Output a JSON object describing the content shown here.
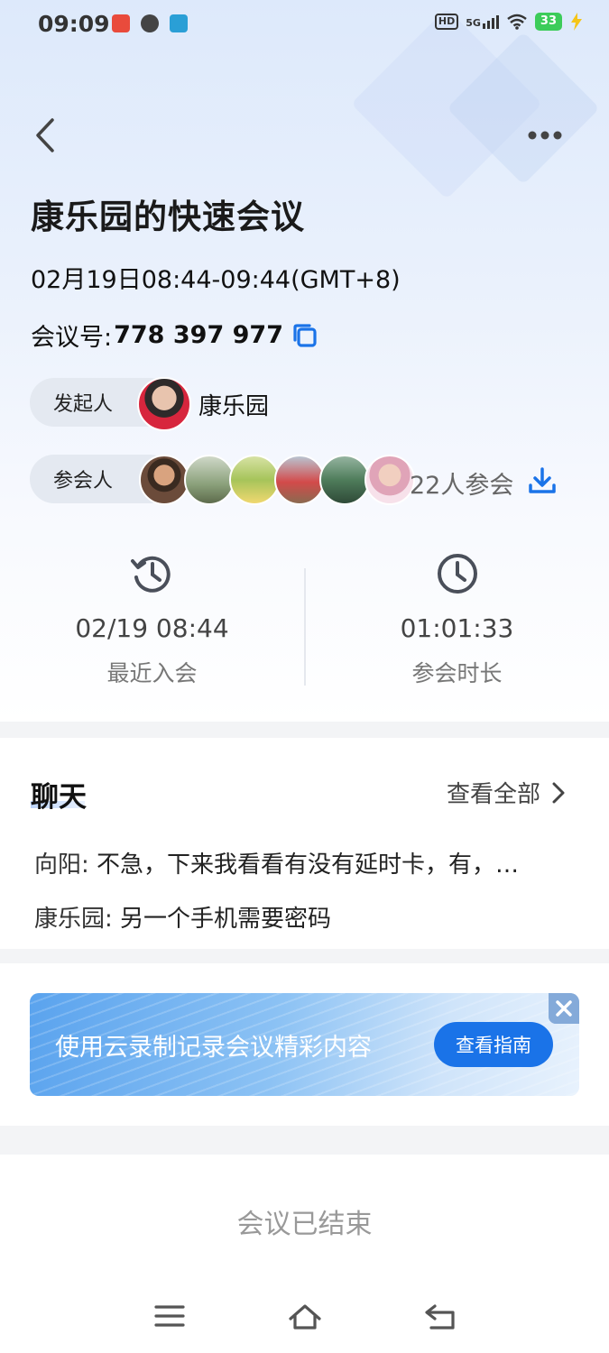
{
  "status_bar": {
    "time": "09:09",
    "network": "5G",
    "hd": "HD",
    "battery": "33"
  },
  "header": {
    "back_icon": "chevron-left-icon",
    "more_icon": "more-dots-icon"
  },
  "meeting": {
    "title": "康乐园的快速会议",
    "time_range": "02月19日08:44-09:44(GMT+8)",
    "id_label": "会议号:",
    "id_value": "778 397 977",
    "host_label": "发起人",
    "host_name": "康乐园",
    "participants_label": "参会人",
    "participants_count": "22人参会"
  },
  "stats": {
    "recent_join_time": "02/19 08:44",
    "recent_join_label": "最近入会",
    "duration_value": "01:01:33",
    "duration_label": "参会时长"
  },
  "chat": {
    "title": "聊天",
    "see_all": "查看全部",
    "messages": [
      {
        "sender": "向阳:",
        "text": "不急，下来我看看有没有延时卡，有，…"
      },
      {
        "sender": "康乐园:",
        "text": "另一个手机需要密码"
      }
    ]
  },
  "banner": {
    "text": "使用云录制记录会议精彩内容",
    "button": "查看指南"
  },
  "footer": {
    "ended_text": "会议已结束"
  },
  "colors": {
    "accent": "#1a73e8",
    "icon_blue": "#1a73e8",
    "battery_green": "#3ccc5a"
  }
}
